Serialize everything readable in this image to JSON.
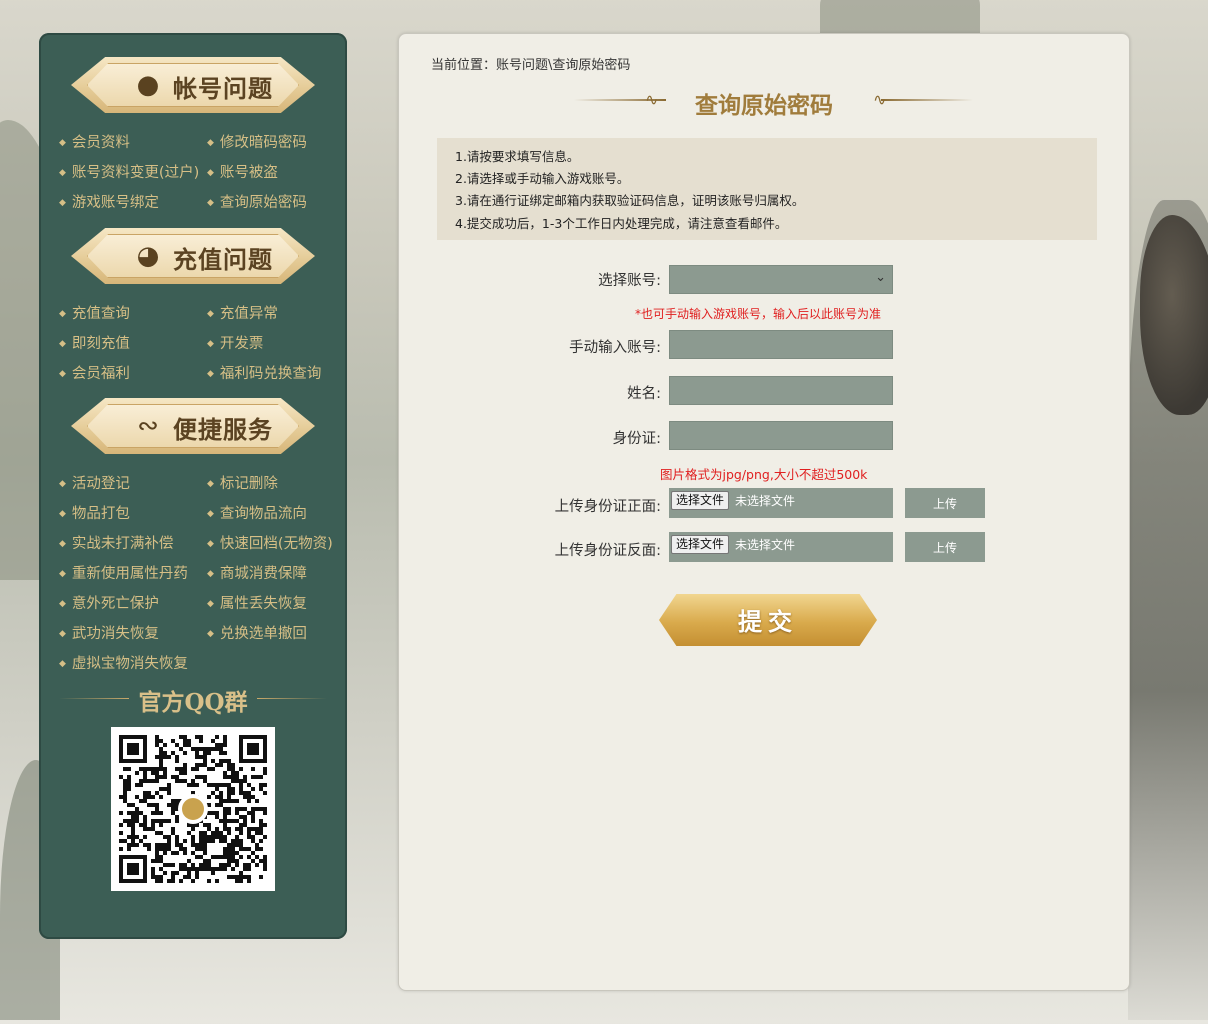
{
  "sidebar": {
    "categories": [
      {
        "title": "帐号问题",
        "icon": "user-silhouette-icon",
        "links": [
          "会员资料",
          "修改暗码密码",
          "账号资料变更(过户)",
          "账号被盗",
          "游戏账号绑定",
          "查询原始密码"
        ]
      },
      {
        "title": "充值问题",
        "icon": "gold-ingot-icon",
        "links": [
          "充值查询",
          "充值异常",
          "即刻充值",
          "开发票",
          "会员福利",
          "福利码兑换查询"
        ]
      },
      {
        "title": "便捷服务",
        "icon": "whirlwind-icon",
        "links": [
          "活动登记",
          "标记删除",
          "物品打包",
          "查询物品流向",
          "实战未打满补偿",
          "快速回档(无物资)",
          "重新使用属性丹药",
          "商城消费保障",
          "意外死亡保护",
          "属性丢失恢复",
          "武功消失恢复",
          "兑换选单撤回",
          "虚拟宝物消失恢复"
        ]
      }
    ],
    "qq_title": "官方QQ群"
  },
  "main": {
    "breadcrumb": "当前位置：账号问题\\查询原始密码",
    "title": "查询原始密码",
    "notice": [
      "1.请按要求填写信息。",
      "2.请选择或手动输入游戏账号。",
      "3.请在通行证绑定邮箱内获取验证码信息，证明该账号归属权。",
      "4.提交成功后，1-3个工作日内处理完成，请注意查看邮件。"
    ],
    "form": {
      "select_account_label": "选择账号:",
      "manual_hint": "*也可手动输入游戏账号，输入后以此账号为准",
      "manual_account_label": "手动输入账号:",
      "name_label": "姓名:",
      "id_label": "身份证:",
      "image_hint": "图片格式为jpg/png,大小不超过500k",
      "id_front_label": "上传身份证正面:",
      "id_back_label": "上传身份证反面:",
      "choose_file": "选择文件",
      "no_file": "未选择文件",
      "upload": "上传",
      "submit": "提交"
    }
  },
  "colors": {
    "sidebar_bg": "#3c5e55",
    "link_gold": "#d6bf86",
    "title_gold": "#a07c3c",
    "hint_red": "#e02020",
    "field_bg": "#8c9a90"
  }
}
